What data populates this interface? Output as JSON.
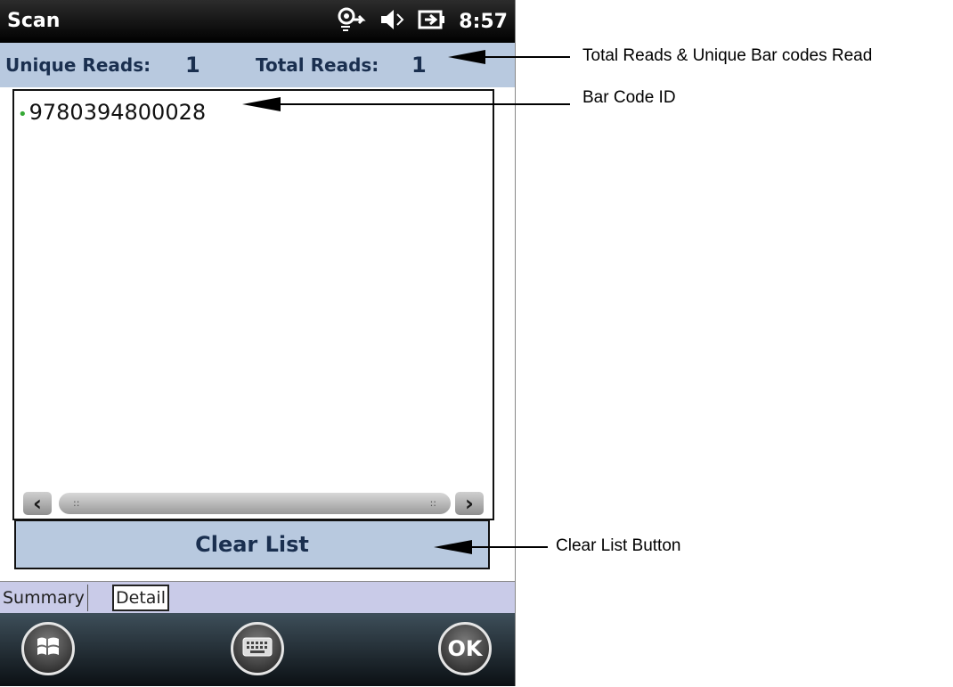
{
  "device": {
    "title": "Scan",
    "clock": "8:57",
    "counts": {
      "unique_label": "Unique Reads:",
      "unique_value": "1",
      "total_label": "Total Reads:",
      "total_value": "1"
    },
    "list_items": [
      "9780394800028"
    ],
    "clear_button_label": "Clear List",
    "tabs": [
      "Summary",
      "Detail"
    ],
    "active_tab": "Detail",
    "softkeys": {
      "right_label": "OK"
    },
    "icons": [
      "connectivity-icon",
      "speaker-mute-icon",
      "battery-charging-icon",
      "windows-start-icon",
      "keyboard-icon"
    ]
  },
  "annotations": {
    "reads": "Total Reads & Unique Bar codes Read",
    "barcode": "Bar Code ID",
    "clear_button": "Clear List Button"
  },
  "colors": {
    "header_band": "#b8c9df",
    "tab_bar": "#c9cbe8",
    "list_dot": "#35a935"
  }
}
